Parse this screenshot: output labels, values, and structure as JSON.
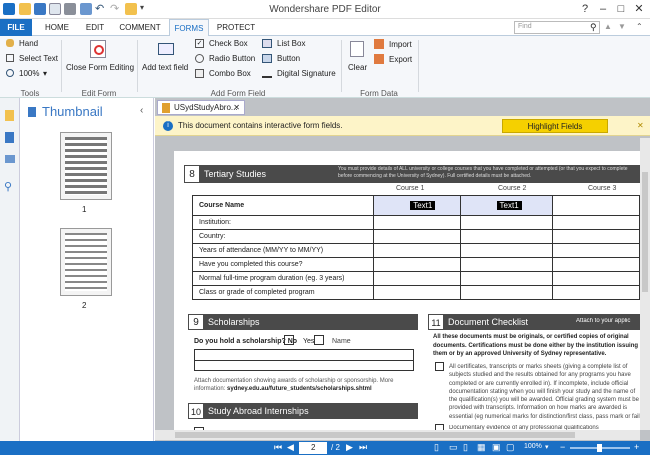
{
  "window": {
    "title": "Wondershare PDF Editor"
  },
  "menu_tabs": [
    "FILE",
    "HOME",
    "EDIT",
    "COMMENT",
    "FORMS",
    "PROTECT"
  ],
  "search": {
    "placeholder": "Find"
  },
  "ribbon": {
    "tools": {
      "hand": "Hand",
      "select_text": "Select Text",
      "zoom": "100%",
      "group": "Tools"
    },
    "edit_form": {
      "close": "Close Form Editing",
      "group": "Edit Form"
    },
    "add_form_field": {
      "add_text_field": "Add text field",
      "check_box": "Check Box",
      "radio_button": "Radio Button",
      "combo_box": "Combo Box",
      "list_box": "List Box",
      "button": "Button",
      "digital_signature": "Digital Signature",
      "group": "Add Form Field"
    },
    "form_data": {
      "clear": "Clear",
      "import": "Import",
      "export": "Export",
      "group": "Form Data"
    }
  },
  "thumbnail": {
    "title": "Thumbnail",
    "pages": [
      "1",
      "2"
    ]
  },
  "doc_tab": {
    "label": "USydStudyAbro..."
  },
  "notice": {
    "text": "This document contains interactive form fields.",
    "button": "Highlight Fields"
  },
  "form": {
    "section8": {
      "num": "8",
      "title": "Tertiary Studies",
      "desc": "You must provide details of ALL university or college courses that you have completed or attempted (or that you expect to complete before commencing at the University of Sydney). Full certified details must be attached."
    },
    "course_headers": [
      "Course 1",
      "Course 2",
      "Course 3"
    ],
    "rows": [
      "Course Name",
      "Institution:",
      "Country:",
      "Years of attendance (MM/YY to MM/YY)",
      "Have you completed this course?",
      "Normal full-time program duration (eg. 3 years)",
      "Class or grade of completed program"
    ],
    "text_field_label": "Text1",
    "section9": {
      "num": "9",
      "title": "Scholarships",
      "question": "Do you hold a scholarship? No",
      "yes": "Yes",
      "name": "Name",
      "attach": "Attach documentation showing awards of scholarship or sponsorship. More information: ",
      "link": "sydney.edu.au/future_students/scholarships.shtml"
    },
    "section10": {
      "num": "10",
      "title": "Study Abroad Internships"
    },
    "section11": {
      "num": "11",
      "title": "Document Checklist",
      "attach_to": "Attach to your applic",
      "intro": "All these documents must be originals, or certified copies of original documents. Certifications must be done either by the institution issuing them or by an approved University of Sydney representative.",
      "item1": "All certificates, transcripts or marks sheets (giving a complete list of subjects studied and the results obtained for any programs you have completed or are currently enrolled in). If incomplete, include official documentation stating when you will finish your study and the name of the qualification(s) you will be awarded. Official grading system must be provided with transcripts. Information on how marks are awarded is essential (eg numerical marks for distinction/first class, pass mark or fail mark).",
      "item2": "Documentary evidence of any professional qualifications"
    }
  },
  "status": {
    "page": "2",
    "total": "/ 2",
    "zoom": "100%"
  }
}
